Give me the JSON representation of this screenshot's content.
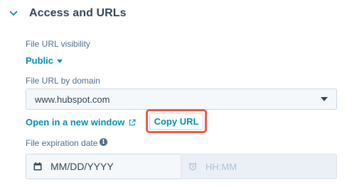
{
  "section": {
    "title": "Access and URLs",
    "expanded_icon": "chevron-down-icon"
  },
  "visibility": {
    "label": "File URL visibility",
    "value": "Public"
  },
  "domain": {
    "label": "File URL by domain",
    "value": "www.hubspot.com"
  },
  "actions": {
    "open_link": "Open in a new window",
    "open_icon": "external-link-icon",
    "copy_url": "Copy URL",
    "highlight_color": "#ee5a45"
  },
  "expiration": {
    "label": "File expiration date",
    "info_icon": "info-icon",
    "date_placeholder": "MM/DD/YYYY",
    "date_icon": "calendar-icon",
    "time_placeholder": "HH:MM",
    "time_icon": "alarm-clock-icon"
  },
  "colors": {
    "link": "#0091ae",
    "text": "#33475b",
    "muted": "#516f90",
    "input_bg": "#f5f8fa"
  }
}
